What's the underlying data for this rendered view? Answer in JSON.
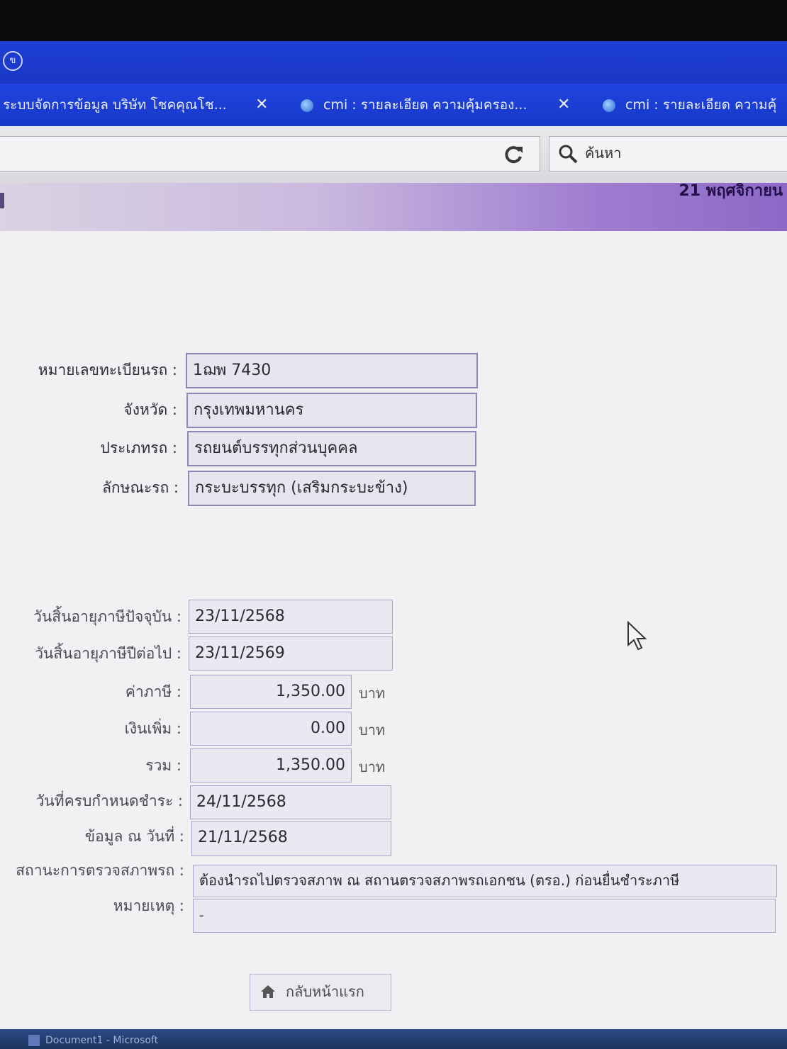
{
  "browser": {
    "tabs": [
      {
        "label": "ระบบจัดการข้อมูล บริษัท โชคคุณโช..."
      },
      {
        "label": "cmi : รายละเอียด ความคุ้มครอง..."
      },
      {
        "label": "cmi : รายละเอียด ความคุ้"
      }
    ],
    "search_placeholder": "ค้นหา"
  },
  "banner": {
    "date": "21 พฤศจิกายน"
  },
  "vehicle": {
    "plate_label": "หมายเลขทะเบียนรถ :",
    "plate_value": "1ฌพ 7430",
    "province_label": "จังหวัด :",
    "province_value": "กรุงเทพมหานคร",
    "type_label": "ประเภทรถ :",
    "type_value": "รถยนต์บรรทุกส่วนบุคคล",
    "body_label": "ลักษณะรถ :",
    "body_value": "กระบะบรรทุก (เสริมกระบะข้าง)"
  },
  "tax": {
    "current_expiry_label": "วันสิ้นอายุภาษีปัจจุบัน :",
    "current_expiry_value": "23/11/2568",
    "next_expiry_label": "วันสิ้นอายุภาษีปีต่อไป :",
    "next_expiry_value": "23/11/2569",
    "tax_label": "ค่าภาษี :",
    "tax_value": "1,350.00",
    "surcharge_label": "เงินเพิ่ม :",
    "surcharge_value": "0.00",
    "total_label": "รวม :",
    "total_value": "1,350.00",
    "currency": "บาท",
    "due_date_label": "วันที่ครบกำหนดชำระ :",
    "due_date_value": "24/11/2568",
    "data_as_of_label": "ข้อมูล ณ วันที่ :",
    "data_as_of_value": "21/11/2568",
    "inspection_label": "สถานะการตรวจสภาพรถ :",
    "inspection_value": "ต้องนำรถไปตรวจสภาพ ณ สถานตรวจสภาพรถเอกชน (ตรอ.) ก่อนยื่นชำระภาษี",
    "remark_label": "หมายเหตุ :",
    "remark_value": "-"
  },
  "home_button_label": "กลับหน้าแรก",
  "taskbar": {
    "item_label": "Document1 - Microsoft"
  }
}
